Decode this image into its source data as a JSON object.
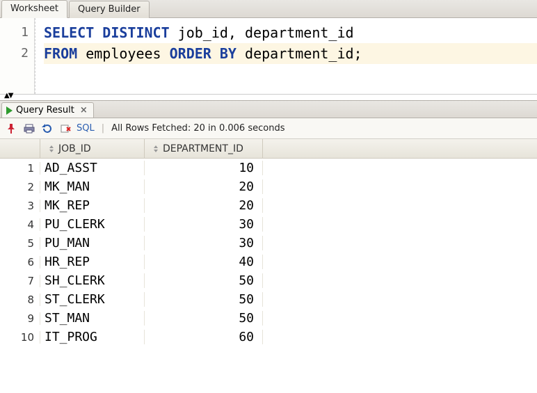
{
  "tabs": {
    "worksheet": "Worksheet",
    "query_builder": "Query Builder"
  },
  "editor": {
    "lines": [
      {
        "num": "1",
        "tokens": [
          {
            "t": "SELECT",
            "c": "kw"
          },
          {
            "t": " "
          },
          {
            "t": "DISTINCT",
            "c": "kw"
          },
          {
            "t": " job_id, department_id"
          }
        ]
      },
      {
        "num": "2",
        "hl": true,
        "tokens": [
          {
            "t": "FROM",
            "c": "kw"
          },
          {
            "t": " employees "
          },
          {
            "t": "ORDER",
            "c": "kw"
          },
          {
            "t": " "
          },
          {
            "t": "BY",
            "c": "kw"
          },
          {
            "t": " department_id;"
          }
        ]
      }
    ]
  },
  "result_tab": {
    "label": "Query Result",
    "close": "×"
  },
  "toolbar": {
    "sql_link": "SQL",
    "status": "All Rows Fetched: 20 in 0.006 seconds"
  },
  "grid": {
    "columns": [
      "JOB_ID",
      "DEPARTMENT_ID"
    ],
    "rows": [
      {
        "n": "1",
        "c": [
          "AD_ASST",
          "10"
        ]
      },
      {
        "n": "2",
        "c": [
          "MK_MAN",
          "20"
        ]
      },
      {
        "n": "3",
        "c": [
          "MK_REP",
          "20"
        ]
      },
      {
        "n": "4",
        "c": [
          "PU_CLERK",
          "30"
        ]
      },
      {
        "n": "5",
        "c": [
          "PU_MAN",
          "30"
        ]
      },
      {
        "n": "6",
        "c": [
          "HR_REP",
          "40"
        ]
      },
      {
        "n": "7",
        "c": [
          "SH_CLERK",
          "50"
        ]
      },
      {
        "n": "8",
        "c": [
          "ST_CLERK",
          "50"
        ]
      },
      {
        "n": "9",
        "c": [
          "ST_MAN",
          "50"
        ]
      },
      {
        "n": "10",
        "c": [
          "IT_PROG",
          "60"
        ]
      }
    ]
  }
}
